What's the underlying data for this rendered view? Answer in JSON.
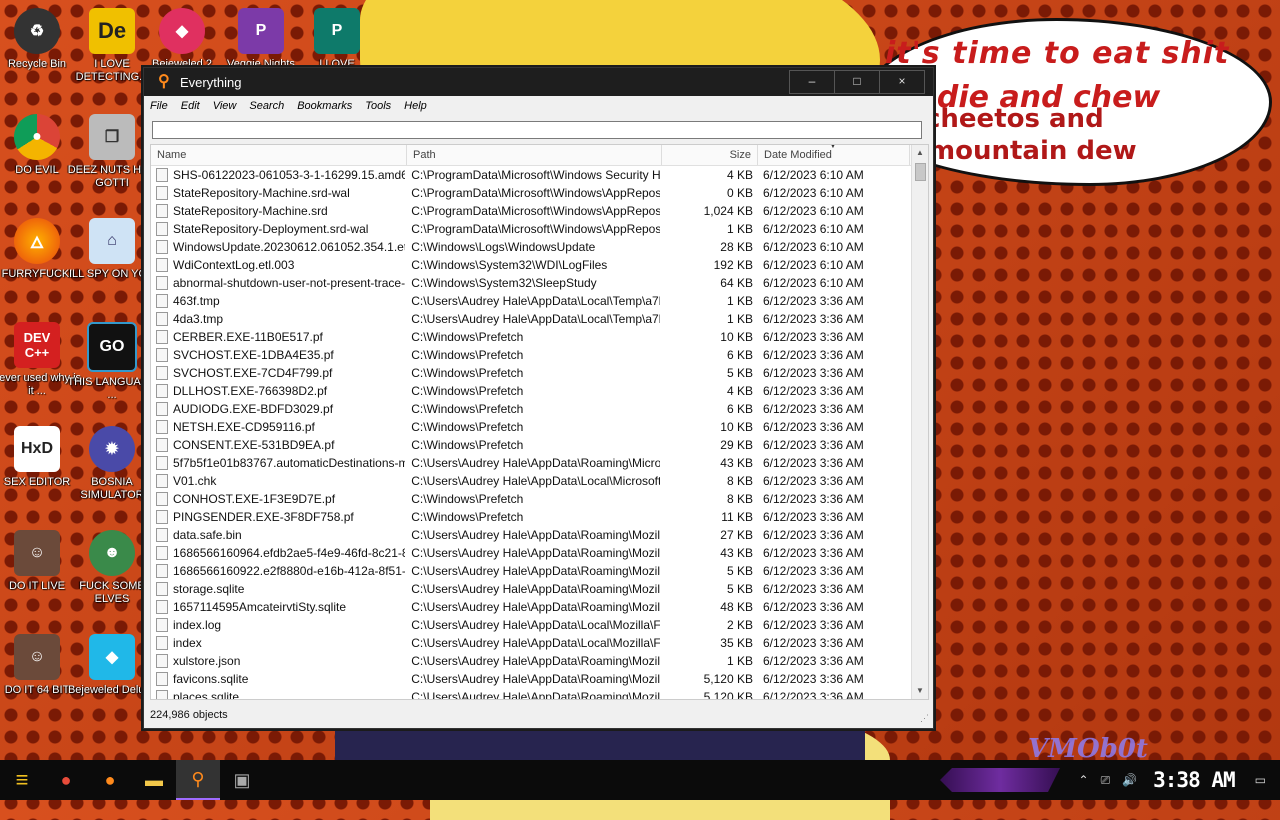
{
  "wallpaper": {
    "speech_lines": [
      "it's time to eat shit",
      "d die and chew",
      "cheetos and",
      "mountain dew"
    ],
    "signature": "VMOb0t"
  },
  "desktop_icons": [
    {
      "label": "Recycle Bin",
      "icon": "recycle-bin-icon"
    },
    {
      "label": "I LOVE DETECTING...",
      "icon": "detect-it-easy-icon"
    },
    {
      "label": "Bejeweled 2",
      "icon": "bejeweled-icon"
    },
    {
      "label": "Veggie Nights",
      "icon": "veggie-icon"
    },
    {
      "label": "I LOVE",
      "icon": "publisher-icon"
    },
    {
      "label": "DO EVIL",
      "icon": "chrome-icon"
    },
    {
      "label": "DEEZ NUTS HAH GOTTI",
      "icon": "copies-icon"
    },
    {
      "label": "FURRYFUCK!",
      "icon": "firefox-icon"
    },
    {
      "label": "ILL SPY ON YOU",
      "icon": "network-icon"
    },
    {
      "label": "never used why is it ...",
      "icon": "devcpp-icon"
    },
    {
      "label": "THIS LANGUAGE ...",
      "icon": "goland-icon"
    },
    {
      "label": "SEX EDITOR",
      "icon": "hxd-icon"
    },
    {
      "label": "BOSNIA SIMULATOR",
      "icon": "mine-icon"
    },
    {
      "label": "DO IT LIVE",
      "icon": "portrait-icon"
    },
    {
      "label": "FUCK SOME ELVES",
      "icon": "elf-icon"
    },
    {
      "label": "DO IT 64 BIT",
      "icon": "portrait64-icon"
    },
    {
      "label": "Bejeweled Deluxe",
      "icon": "diamond-icon"
    }
  ],
  "window": {
    "title": "Everything",
    "controls": {
      "minimize": "–",
      "maximize": "□",
      "close": "×"
    },
    "menu": [
      "File",
      "Edit",
      "View",
      "Search",
      "Bookmarks",
      "Tools",
      "Help"
    ],
    "search": {
      "value": "",
      "placeholder": ""
    },
    "columns": {
      "name": "Name",
      "path": "Path",
      "size": "Size",
      "date": "Date Modified"
    },
    "rows": [
      {
        "name": "SHS-06122023-061053-3-1-16299.15.amd64f...",
        "path": "C:\\ProgramData\\Microsoft\\Windows Security Heal...",
        "size": "4 KB",
        "date": "6/12/2023 6:10 AM"
      },
      {
        "name": "StateRepository-Machine.srd-wal",
        "path": "C:\\ProgramData\\Microsoft\\Windows\\AppRepository",
        "size": "0 KB",
        "date": "6/12/2023 6:10 AM"
      },
      {
        "name": "StateRepository-Machine.srd",
        "path": "C:\\ProgramData\\Microsoft\\Windows\\AppRepository",
        "size": "1,024 KB",
        "date": "6/12/2023 6:10 AM"
      },
      {
        "name": "StateRepository-Deployment.srd-wal",
        "path": "C:\\ProgramData\\Microsoft\\Windows\\AppRepository",
        "size": "1 KB",
        "date": "6/12/2023 6:10 AM"
      },
      {
        "name": "WindowsUpdate.20230612.061052.354.1.etl",
        "path": "C:\\Windows\\Logs\\WindowsUpdate",
        "size": "28 KB",
        "date": "6/12/2023 6:10 AM"
      },
      {
        "name": "WdiContextLog.etl.003",
        "path": "C:\\Windows\\System32\\WDI\\LogFiles",
        "size": "192 KB",
        "date": "6/12/2023 6:10 AM"
      },
      {
        "name": "abnormal-shutdown-user-not-present-trace-2...",
        "path": "C:\\Windows\\System32\\SleepStudy",
        "size": "64 KB",
        "date": "6/12/2023 6:10 AM"
      },
      {
        "name": "463f.tmp",
        "path": "C:\\Users\\Audrey Hale\\AppData\\Local\\Temp\\a7b...",
        "size": "1 KB",
        "date": "6/12/2023 3:36 AM"
      },
      {
        "name": "4da3.tmp",
        "path": "C:\\Users\\Audrey Hale\\AppData\\Local\\Temp\\a7b...",
        "size": "1 KB",
        "date": "6/12/2023 3:36 AM"
      },
      {
        "name": "CERBER.EXE-11B0E517.pf",
        "path": "C:\\Windows\\Prefetch",
        "size": "10 KB",
        "date": "6/12/2023 3:36 AM"
      },
      {
        "name": "SVCHOST.EXE-1DBA4E35.pf",
        "path": "C:\\Windows\\Prefetch",
        "size": "6 KB",
        "date": "6/12/2023 3:36 AM"
      },
      {
        "name": "SVCHOST.EXE-7CD4F799.pf",
        "path": "C:\\Windows\\Prefetch",
        "size": "5 KB",
        "date": "6/12/2023 3:36 AM"
      },
      {
        "name": "DLLHOST.EXE-766398D2.pf",
        "path": "C:\\Windows\\Prefetch",
        "size": "4 KB",
        "date": "6/12/2023 3:36 AM"
      },
      {
        "name": "AUDIODG.EXE-BDFD3029.pf",
        "path": "C:\\Windows\\Prefetch",
        "size": "6 KB",
        "date": "6/12/2023 3:36 AM"
      },
      {
        "name": "NETSH.EXE-CD959116.pf",
        "path": "C:\\Windows\\Prefetch",
        "size": "10 KB",
        "date": "6/12/2023 3:36 AM"
      },
      {
        "name": "CONSENT.EXE-531BD9EA.pf",
        "path": "C:\\Windows\\Prefetch",
        "size": "29 KB",
        "date": "6/12/2023 3:36 AM"
      },
      {
        "name": "5f7b5f1e01b83767.automaticDestinations-ms",
        "path": "C:\\Users\\Audrey Hale\\AppData\\Roaming\\Micros...",
        "size": "43 KB",
        "date": "6/12/2023 3:36 AM"
      },
      {
        "name": "V01.chk",
        "path": "C:\\Users\\Audrey Hale\\AppData\\Local\\Microsoft\\...",
        "size": "8 KB",
        "date": "6/12/2023 3:36 AM"
      },
      {
        "name": "CONHOST.EXE-1F3E9D7E.pf",
        "path": "C:\\Windows\\Prefetch",
        "size": "8 KB",
        "date": "6/12/2023 3:36 AM"
      },
      {
        "name": "PINGSENDER.EXE-3F8DF758.pf",
        "path": "C:\\Windows\\Prefetch",
        "size": "11 KB",
        "date": "6/12/2023 3:36 AM"
      },
      {
        "name": "data.safe.bin",
        "path": "C:\\Users\\Audrey Hale\\AppData\\Roaming\\Mozilla...",
        "size": "27 KB",
        "date": "6/12/2023 3:36 AM"
      },
      {
        "name": "1686566160964.efdb2ae5-f4e9-46fd-8c21-86...",
        "path": "C:\\Users\\Audrey Hale\\AppData\\Roaming\\Mozilla...",
        "size": "43 KB",
        "date": "6/12/2023 3:36 AM"
      },
      {
        "name": "1686566160922.e2f8880d-e16b-412a-8f51-e...",
        "path": "C:\\Users\\Audrey Hale\\AppData\\Roaming\\Mozilla...",
        "size": "5 KB",
        "date": "6/12/2023 3:36 AM"
      },
      {
        "name": "storage.sqlite",
        "path": "C:\\Users\\Audrey Hale\\AppData\\Roaming\\Mozilla...",
        "size": "5 KB",
        "date": "6/12/2023 3:36 AM"
      },
      {
        "name": "1657114595AmcateirvtiSty.sqlite",
        "path": "C:\\Users\\Audrey Hale\\AppData\\Roaming\\Mozilla...",
        "size": "48 KB",
        "date": "6/12/2023 3:36 AM"
      },
      {
        "name": "index.log",
        "path": "C:\\Users\\Audrey Hale\\AppData\\Local\\Mozilla\\Fir...",
        "size": "2 KB",
        "date": "6/12/2023 3:36 AM"
      },
      {
        "name": "index",
        "path": "C:\\Users\\Audrey Hale\\AppData\\Local\\Mozilla\\Fir...",
        "size": "35 KB",
        "date": "6/12/2023 3:36 AM"
      },
      {
        "name": "xulstore.json",
        "path": "C:\\Users\\Audrey Hale\\AppData\\Roaming\\Mozilla...",
        "size": "1 KB",
        "date": "6/12/2023 3:36 AM"
      },
      {
        "name": "favicons.sqlite",
        "path": "C:\\Users\\Audrey Hale\\AppData\\Roaming\\Mozilla...",
        "size": "5,120 KB",
        "date": "6/12/2023 3:36 AM"
      },
      {
        "name": "places.sqlite",
        "path": "C:\\Users\\Audrey Hale\\AppData\\Roaming\\Mozilla...",
        "size": "5,120 KB",
        "date": "6/12/2023 3:36 AM"
      }
    ],
    "status": "224,986 objects"
  },
  "taskbar": {
    "apps": [
      "start-icon",
      "chrome-icon",
      "firefox-icon",
      "file-explorer-icon",
      "everything-icon",
      "app-icon"
    ],
    "clock": "3:38 AM"
  },
  "colors": {
    "accent": "#a06cff",
    "wallpaper": "#c8421a",
    "speech_text": "#c81c1c"
  }
}
